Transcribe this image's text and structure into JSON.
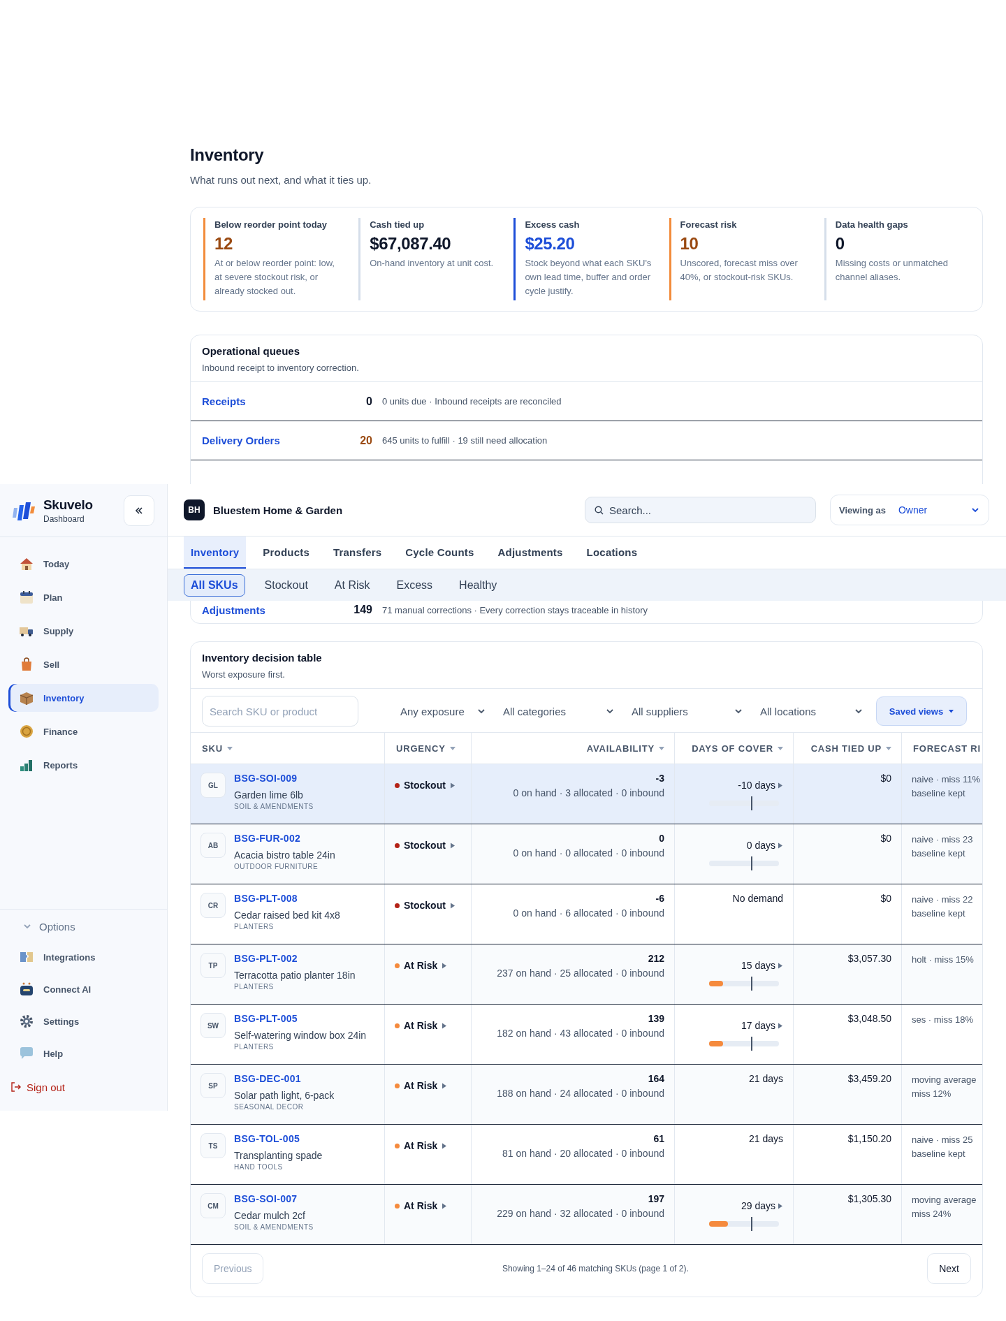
{
  "page": {
    "title": "Inventory",
    "subtitle": "What runs out next, and what it ties up."
  },
  "kpis": [
    {
      "label": "Below reorder point today",
      "value": "12",
      "description": "At or below reorder point: low, at severe stockout risk, or already stocked out.",
      "kind": "warning"
    },
    {
      "label": "Cash tied up",
      "value": "$67,087.40",
      "description": "On-hand inventory at unit cost.",
      "kind": "neutral"
    },
    {
      "label": "Excess cash",
      "value": "$25.20",
      "description": "Stock beyond what each SKU's own lead time, buffer and order cycle justify.",
      "kind": "info"
    },
    {
      "label": "Forecast risk",
      "value": "10",
      "description": "Unscored, forecast miss over 40%, or stockout-risk SKUs.",
      "kind": "warning"
    },
    {
      "label": "Data health gaps",
      "value": "0",
      "description": "Missing costs or unmatched channel aliases.",
      "kind": "neutral"
    }
  ],
  "queues": {
    "title": "Operational queues",
    "subtitle": "Inbound receipt to inventory correction.",
    "rows": [
      {
        "name": "Receipts",
        "count": "0",
        "detail": "0 units due · Inbound receipts are reconciled",
        "kind": "neutral"
      },
      {
        "name": "Delivery Orders",
        "count": "20",
        "detail": "645 units to fulfill · 19 still need allocation",
        "kind": "warning"
      },
      {
        "name": "Adjustments",
        "count": "149",
        "detail": "71 manual corrections · Every correction stays traceable in history",
        "kind": "neutral"
      }
    ]
  },
  "table": {
    "title": "Inventory decision table",
    "subtitle": "Worst exposure first.",
    "search": {
      "placeholder": "Search SKU or product"
    },
    "filters": [
      "Any exposure",
      "All categories",
      "All suppliers",
      "All locations"
    ],
    "saved_views": "Saved views",
    "columns": [
      "SKU",
      "URGENCY",
      "AVAILABILITY",
      "DAYS OF COVER",
      "CASH TIED UP",
      "FORECAST RI"
    ],
    "rows": [
      {
        "initials": "GL",
        "sku": "BSG-SOI-009",
        "name": "Garden lime 6lb",
        "category": "SOIL & AMENDMENTS",
        "urgency": {
          "label": "Stockout",
          "color": "#b42318"
        },
        "available": "-3",
        "breakdown": "0 on hand · 3 allocated · 0 inbound",
        "cover": {
          "text": "-10 days",
          "arrow": true,
          "track": true
        },
        "cash": "$0",
        "forecast": [
          "naive · miss 11%",
          "baseline kept"
        ],
        "selected": true
      },
      {
        "initials": "AB",
        "sku": "BSG-FUR-002",
        "name": "Acacia bistro table 24in",
        "category": "OUTDOOR FURNITURE",
        "urgency": {
          "label": "Stockout",
          "color": "#b42318"
        },
        "available": "0",
        "breakdown": "0 on hand · 0 allocated · 0 inbound",
        "cover": {
          "text": "0 days",
          "arrow": true,
          "track": true
        },
        "cash": "$0",
        "forecast": [
          "naive · miss 23",
          "baseline kept"
        ],
        "selected": false
      },
      {
        "initials": "CR",
        "sku": "BSG-PLT-008",
        "name": "Cedar raised bed kit 4x8",
        "category": "PLANTERS",
        "urgency": {
          "label": "Stockout",
          "color": "#b42318"
        },
        "available": "-6",
        "breakdown": "0 on hand · 6 allocated · 0 inbound",
        "cover": {
          "text": "No demand",
          "arrow": false
        },
        "cash": "$0",
        "forecast": [
          "naive · miss 22",
          "baseline kept"
        ],
        "selected": false
      },
      {
        "initials": "TP",
        "sku": "BSG-PLT-002",
        "name": "Terracotta patio planter 18in",
        "category": "PLANTERS",
        "urgency": {
          "label": "At Risk",
          "color": "#f58a3d"
        },
        "available": "212",
        "breakdown": "237 on hand · 25 allocated · 0 inbound",
        "cover": {
          "text": "15 days",
          "arrow": true,
          "level": 0.2
        },
        "cash": "$3,057.30",
        "forecast": [
          "holt · miss 15%"
        ],
        "selected": false
      },
      {
        "initials": "SW",
        "sku": "BSG-PLT-005",
        "name": "Self-watering window box 24in",
        "category": "PLANTERS",
        "urgency": {
          "label": "At Risk",
          "color": "#f58a3d"
        },
        "available": "139",
        "breakdown": "182 on hand · 43 allocated · 0 inbound",
        "cover": {
          "text": "17 days",
          "arrow": true,
          "level": 0.2
        },
        "cash": "$3,048.50",
        "forecast": [
          "ses · miss 18%"
        ],
        "selected": false
      },
      {
        "initials": "SP",
        "sku": "BSG-DEC-001",
        "name": "Solar path light, 6-pack",
        "category": "SEASONAL DECOR",
        "urgency": {
          "label": "At Risk",
          "color": "#f58a3d"
        },
        "available": "164",
        "breakdown": "188 on hand · 24 allocated · 0 inbound",
        "cover": {
          "text": "21 days",
          "arrow": false
        },
        "cash": "$3,459.20",
        "forecast": [
          "moving average",
          "miss 12%"
        ],
        "selected": false
      },
      {
        "initials": "TS",
        "sku": "BSG-TOL-005",
        "name": "Transplanting spade",
        "category": "HAND TOOLS",
        "urgency": {
          "label": "At Risk",
          "color": "#f58a3d"
        },
        "available": "61",
        "breakdown": "81 on hand · 20 allocated · 0 inbound",
        "cover": {
          "text": "21 days",
          "arrow": false
        },
        "cash": "$1,150.20",
        "forecast": [
          "naive · miss 25",
          "baseline kept"
        ],
        "selected": false
      },
      {
        "initials": "CM",
        "sku": "BSG-SOI-007",
        "name": "Cedar mulch 2cf",
        "category": "SOIL & AMENDMENTS",
        "urgency": {
          "label": "At Risk",
          "color": "#f58a3d"
        },
        "available": "197",
        "breakdown": "229 on hand · 32 allocated · 0 inbound",
        "cover": {
          "text": "29 days",
          "arrow": true,
          "level": 0.27
        },
        "cash": "$1,305.30",
        "forecast": [
          "moving average",
          "miss 24%"
        ],
        "selected": false
      }
    ],
    "pagination": {
      "previous": {
        "label": "Previous",
        "disabled": true
      },
      "summary": "Showing 1–24 of 46 matching SKUs (page 1 of 2).",
      "next": {
        "label": "Next",
        "disabled": false
      }
    }
  },
  "sidebar": {
    "brand": "Skuvelo",
    "subtitle": "Dashboard",
    "items": [
      {
        "label": "Today",
        "selected": false
      },
      {
        "label": "Plan",
        "selected": false
      },
      {
        "label": "Supply",
        "selected": false
      },
      {
        "label": "Sell",
        "selected": false
      },
      {
        "label": "Inventory",
        "selected": true
      },
      {
        "label": "Finance",
        "selected": false
      },
      {
        "label": "Reports",
        "selected": false
      }
    ],
    "options": {
      "label": "Options",
      "expanded": true
    },
    "option_items": [
      "Integrations",
      "Connect AI",
      "Settings",
      "Help"
    ],
    "sign_out": "Sign out"
  },
  "header": {
    "initials": "BH",
    "company": "Bluestem Home & Garden",
    "search": {
      "placeholder": "Search..."
    },
    "viewing_label": "Viewing as",
    "viewing_value": "Owner"
  },
  "tabs": [
    {
      "label": "Inventory",
      "selected": true
    },
    {
      "label": "Products",
      "selected": false
    },
    {
      "label": "Transfers",
      "selected": false
    },
    {
      "label": "Cycle Counts",
      "selected": false
    },
    {
      "label": "Adjustments",
      "selected": false
    },
    {
      "label": "Locations",
      "selected": false
    }
  ],
  "subtabs": [
    {
      "label": "All SKUs",
      "selected": true
    },
    {
      "label": "Stockout",
      "selected": false
    },
    {
      "label": "At Risk",
      "selected": false
    },
    {
      "label": "Excess",
      "selected": false
    },
    {
      "label": "Healthy",
      "selected": false
    }
  ]
}
